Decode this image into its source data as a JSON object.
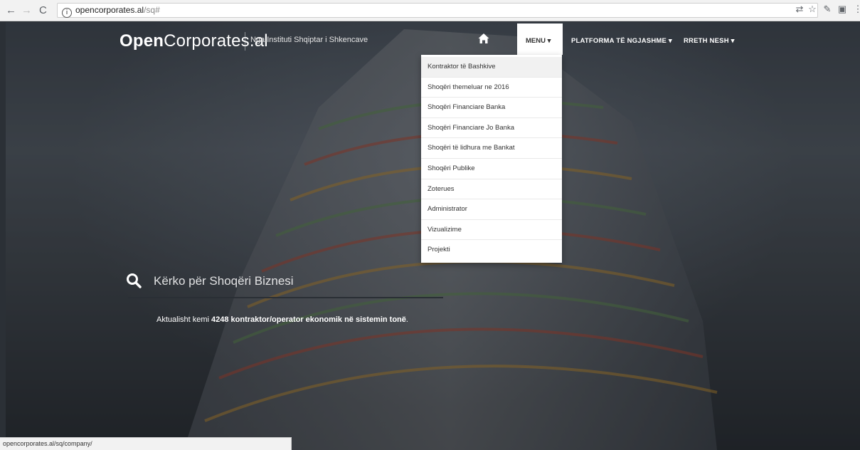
{
  "browser": {
    "back": "←",
    "forward": "→",
    "reload": "C",
    "url_host": "opencorporates.al",
    "url_path": "/sq#"
  },
  "header": {
    "brand_bold": "Open",
    "brand_rest": "Corporates.al",
    "tagline": "Nga Instituti Shqiptar i Shkencave",
    "nav": {
      "menu": "MENU ▾",
      "platforma": "PLATFORMA TË NGJASHME ▾",
      "rreth": "RRETH NESH ▾"
    }
  },
  "dropdown": {
    "items": [
      "Kontraktor të Bashkive",
      "Shoqëri themeluar ne 2016",
      "Shoqëri Financiare Banka",
      "Shoqëri Financiare Jo Banka",
      "Shoqëri të lidhura me Bankat",
      "Shoqëri Publike",
      "Zoterues",
      "Administrator",
      "Vizualizime",
      "Projekti"
    ]
  },
  "search": {
    "placeholder": "Kërko për Shoqëri Biznesi"
  },
  "summary": {
    "prefix": "Aktualisht kemi ",
    "bold": "4248 kontraktor/operator ekonomik në sistemin tonë",
    "suffix": "."
  },
  "status_bar": "opencorporates.al/sq/company/",
  "colors": {
    "background": "#3d444c",
    "text_on_hero": "#ffffff",
    "menu_active_bg": "#ffffff"
  }
}
